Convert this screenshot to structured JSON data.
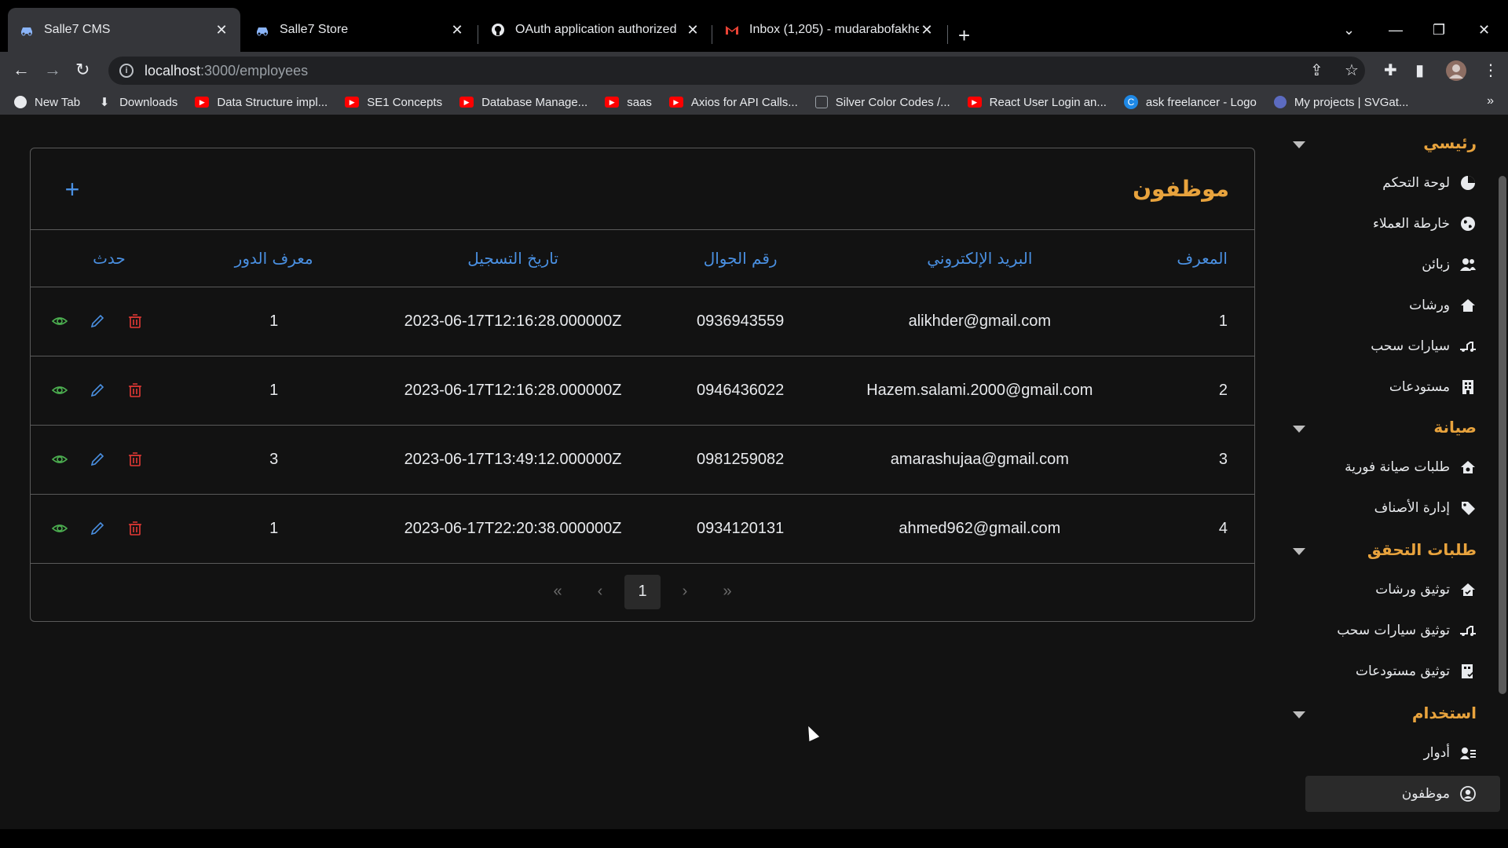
{
  "browser": {
    "tabs": [
      {
        "title": "Salle7 CMS",
        "icon": "car-favicon",
        "active": true
      },
      {
        "title": "Salle7 Store",
        "icon": "car-favicon",
        "active": false
      },
      {
        "title": "OAuth application authorized",
        "icon": "github-icon",
        "active": false
      },
      {
        "title": "Inbox (1,205) - mudarabofakher@",
        "icon": "gmail-icon",
        "active": false
      }
    ],
    "url_host": "localhost",
    "url_path": ":3000/employees",
    "bookmarks": [
      {
        "label": "New Tab",
        "icon": "globe-icon"
      },
      {
        "label": "Downloads",
        "icon": "download-icon"
      },
      {
        "label": "Data Structure impl...",
        "icon": "youtube-icon"
      },
      {
        "label": "SE1 Concepts",
        "icon": "youtube-icon"
      },
      {
        "label": "Database Manage...",
        "icon": "youtube-icon"
      },
      {
        "label": "saas",
        "icon": "youtube-icon"
      },
      {
        "label": "Axios for API Calls...",
        "icon": "youtube-icon"
      },
      {
        "label": "Silver Color Codes /...",
        "icon": "grid-icon"
      },
      {
        "label": "React User Login an...",
        "icon": "youtube-icon"
      },
      {
        "label": "ask freelancer - Logo",
        "icon": "c-icon"
      },
      {
        "label": "My projects | SVGat...",
        "icon": "svg-icon"
      }
    ]
  },
  "page": {
    "title": "موظفون",
    "columns": {
      "id": "المعرف",
      "email": "البريد الإلكتروني",
      "phone": "رقم الجوال",
      "date": "تاريخ التسجيل",
      "role": "معرف الدور",
      "action": "حدث"
    },
    "rows": [
      {
        "id": "1",
        "email": "alikhder@gmail.com",
        "phone": "0936943559",
        "date": "2023-06-17T12:16:28.000000Z",
        "role": "1"
      },
      {
        "id": "2",
        "email": "Hazem.salami.2000@gmail.com",
        "phone": "0946436022",
        "date": "2023-06-17T12:16:28.000000Z",
        "role": "1"
      },
      {
        "id": "3",
        "email": "amarashujaa@gmail.com",
        "phone": "0981259082",
        "date": "2023-06-17T13:49:12.000000Z",
        "role": "3"
      },
      {
        "id": "4",
        "email": "ahmed962@gmail.com",
        "phone": "0934120131",
        "date": "2023-06-17T22:20:38.000000Z",
        "role": "1"
      }
    ],
    "pager": {
      "first": "«",
      "prev": "‹",
      "current": "1",
      "next": "›",
      "last": "»"
    }
  },
  "sidebar": {
    "sections": [
      {
        "label": "رئيسي"
      },
      {
        "label": "صيانة"
      },
      {
        "label": "طلبات التحقق"
      },
      {
        "label": "استخدام"
      }
    ],
    "items": [
      {
        "label": "لوحة التحكم",
        "icon": "pie-chart-icon"
      },
      {
        "label": "خارطة العملاء",
        "icon": "globe-icon"
      },
      {
        "label": "زبائن",
        "icon": "users-icon"
      },
      {
        "label": "ورشات",
        "icon": "home-icon"
      },
      {
        "label": "سيارات سحب",
        "icon": "tow-truck-icon"
      },
      {
        "label": "مستودعات",
        "icon": "building-icon"
      },
      {
        "label": "طلبات صيانة فورية",
        "icon": "home-wrench-icon"
      },
      {
        "label": "إدارة الأصناف",
        "icon": "tag-icon"
      },
      {
        "label": "توثيق ورشات",
        "icon": "home-check-icon"
      },
      {
        "label": "توثيق سيارات سحب",
        "icon": "tow-truck-icon"
      },
      {
        "label": "توثيق مستودعات",
        "icon": "building-check-icon"
      },
      {
        "label": "أدوار",
        "icon": "id-card-icon"
      },
      {
        "label": "موظفون",
        "icon": "user-circle-icon"
      }
    ]
  },
  "colors": {
    "accent": "#e8a33d",
    "link": "#4a90e2",
    "view": "#4caf50",
    "delete": "#e53935"
  }
}
